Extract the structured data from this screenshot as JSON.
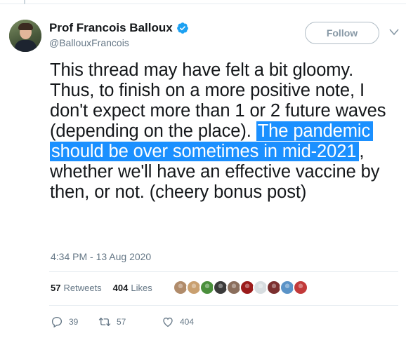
{
  "tweet": {
    "display_name": "Prof Francois Balloux",
    "handle": "@BallouxFrancois",
    "follow_label": "Follow",
    "text_before": "This thread may have felt a bit gloomy. Thus, to finish on a more positive note, I don't expect more than 1 or 2 future waves (depending on the place). ",
    "text_highlighted": "The pandemic should be over sometimes in mid-2021",
    "text_after": ", whether we'll have an effective vaccine by then, or not. (cheery bonus post)",
    "timestamp": "4:34 PM - 13 Aug 2020"
  },
  "stats": {
    "retweets_count": "57",
    "retweets_label": "Retweets",
    "likes_count": "404",
    "likes_label": "Likes"
  },
  "liker_avatars": [
    {
      "color": "#b08b6a"
    },
    {
      "color": "#c9a070"
    },
    {
      "color": "#4a8f3c"
    },
    {
      "color": "#3a3a3a"
    },
    {
      "color": "#8a6e5c"
    },
    {
      "color": "#9b1b1b"
    },
    {
      "color": "#d7dde0"
    },
    {
      "color": "#7b2f2f"
    },
    {
      "color": "#5a93c7"
    },
    {
      "color": "#c23a3a"
    }
  ],
  "actions": {
    "replies": "39",
    "retweets": "57",
    "likes": "404"
  },
  "colors": {
    "accent": "#1da1f2",
    "highlight": "#1b90ff",
    "muted": "#657786"
  }
}
